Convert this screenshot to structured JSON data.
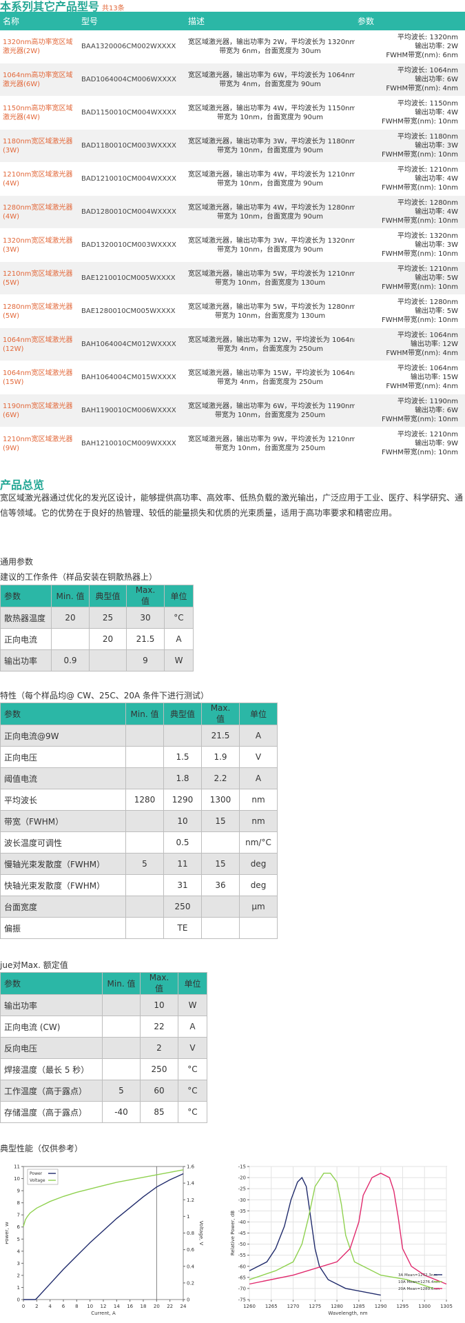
{
  "series_section": {
    "title": "本系列其它产品型号",
    "count": "共13条",
    "headers": [
      "名称",
      "型号",
      "描述",
      "参数"
    ],
    "rows": [
      {
        "name": "1320nm高功率宽区域激光器(2W)",
        "model": "BAA1320006CM002WXXXX",
        "desc": [
          "宽区域激光器，输出功率为 2W，平均波长为 1320nm,",
          "带宽为 6nm，台面宽度为 30um"
        ],
        "params": [
          "平均波长: 1320nm",
          "输出功率: 2W",
          "FWHM带宽(nm): 6nm"
        ]
      },
      {
        "name": "1064nm高功率宽区域激光器(6W)",
        "model": "BAD1064004CM006WXXXX",
        "desc": [
          "宽区域激光器，输出功率为 6W，平均波长为 1064nm,",
          "带宽为 4nm，台面宽度为 90um"
        ],
        "params": [
          "平均波长: 1064nm",
          "输出功率: 6W",
          "FWHM带宽(nm): 4nm"
        ]
      },
      {
        "name": "1150nm高功率宽区域激光器(4W)",
        "model": "BAD1150010CM004WXXXX",
        "desc": [
          "宽区域激光器，输出功率为 4W，平均波长为 1150nm,",
          "带宽为 10nm，台面宽度为 90um"
        ],
        "params": [
          "平均波长: 1150nm",
          "输出功率: 4W",
          "FWHM带宽(nm): 10nm"
        ]
      },
      {
        "name": "1180nm宽区域激光器(3W)",
        "model": "BAD1180010CM003WXXXX",
        "desc": [
          "宽区域激光器，输出功率为 3W，平均波长为 1180nm,",
          "带宽为 10nm，台面宽度为 90um"
        ],
        "params": [
          "平均波长: 1180nm",
          "输出功率: 3W",
          "FWHM带宽(nm): 10nm"
        ]
      },
      {
        "name": "1210nm宽区域激光器(4W)",
        "model": "BAD1210010CM004WXXXX",
        "desc": [
          "宽区域激光器，输出功率为 4W，平均波长为 1210nm,",
          "带宽为 10nm，台面宽度为 90um"
        ],
        "params": [
          "平均波长: 1210nm",
          "输出功率: 4W",
          "FWHM带宽(nm): 10nm"
        ]
      },
      {
        "name": "1280nm宽区域激光器(4W)",
        "model": "BAD1280010CM004WXXXX",
        "desc": [
          "宽区域激光器，输出功率为 4W，平均波长为 1280nm,",
          "带宽为 10nm，台面宽度为 90um"
        ],
        "params": [
          "平均波长: 1280nm",
          "输出功率: 4W",
          "FWHM带宽(nm): 10nm"
        ]
      },
      {
        "name": "1320nm宽区域激光器(3W)",
        "model": "BAD1320010CM003WXXXX",
        "desc": [
          "宽区域激光器，输出功率为 3W，平均波长为 1320nm,",
          "带宽为 10nm，台面宽度为 90um"
        ],
        "params": [
          "平均波长: 1320nm",
          "输出功率: 3W",
          "FWHM带宽(nm): 10nm"
        ]
      },
      {
        "name": "1210nm宽区域激光器(5W)",
        "model": "BAE1210010CM005WXXXX",
        "desc": [
          "宽区域激光器，输出功率为 5W，平均波长为 1210nm,",
          "带宽为 10nm，台面宽度为 130um"
        ],
        "params": [
          "平均波长: 1210nm",
          "输出功率: 5W",
          "FWHM带宽(nm): 10nm"
        ]
      },
      {
        "name": "1280nm宽区域激光器(5W)",
        "model": "BAE1280010CM005WXXXX",
        "desc": [
          "宽区域激光器，输出功率为 5W，平均波长为 1280nm,",
          "带宽为 10nm，台面宽度为 130um"
        ],
        "params": [
          "平均波长: 1280nm",
          "输出功率: 5W",
          "FWHM带宽(nm): 10nm"
        ]
      },
      {
        "name": "1064nm宽区域激光器(12W)",
        "model": "BAH1064004CM012WXXXX",
        "desc": [
          "宽区域激光器，输出功率为 12W，平均波长为 1064nm,",
          "带宽为 4nm，台面宽度为 250um"
        ],
        "params": [
          "平均波长: 1064nm",
          "输出功率: 12W",
          "FWHM带宽(nm): 4nm"
        ]
      },
      {
        "name": "1064nm宽区域激光器(15W)",
        "model": "BAH1064004CM015WXXXX",
        "desc": [
          "宽区域激光器，输出功率为 15W，平均波长为 1064nm,",
          "带宽为 4nm，台面宽度为 250um"
        ],
        "params": [
          "平均波长: 1064nm",
          "输出功率: 15W",
          "FWHM带宽(nm): 4nm"
        ]
      },
      {
        "name": "1190nm宽区域激光器(6W)",
        "model": "BAH1190010CM006WXXXX",
        "desc": [
          "宽区域激光器，输出功率为 6W，平均波长为 1190nm,",
          "带宽为 10nm，台面宽度为 250um"
        ],
        "params": [
          "平均波长: 1190nm",
          "输出功率: 6W",
          "FWHM带宽(nm): 10nm"
        ]
      },
      {
        "name": "1210nm宽区域激光器(9W)",
        "model": "BAH1210010CM009WXXXX",
        "desc": [
          "宽区域激光器，输出功率为 9W，平均波长为 1210nm,",
          "带宽为 10nm，台面宽度为 250um"
        ],
        "params": [
          "平均波长: 1210nm",
          "输出功率: 9W",
          "FWHM带宽(nm): 10nm"
        ]
      }
    ]
  },
  "overview": {
    "title": "产品总览",
    "text": "宽区域激光器通过优化的发光区设计，能够提供高功率、高效率、低热负载的激光输出，广泛应用于工业、医疗、科学研究、通信等领域。它的优势在于良好的热管理、较低的能量损失和优质的光束质量，适用于高功率要求和精密应用。"
  },
  "general": {
    "label": "通用参数",
    "cond_label": "建议的工作条件（样品安装在铜散热器上）",
    "headers": [
      "参数",
      "Min. 值",
      "典型值",
      "Max. 值",
      "单位"
    ],
    "rows": [
      [
        "散热器温度",
        "20",
        "25",
        "30",
        "°C"
      ],
      [
        "正向电流",
        "",
        "20",
        "21.5",
        "A"
      ],
      [
        "输出功率",
        "0.9",
        "",
        "9",
        "W"
      ]
    ]
  },
  "characteristics": {
    "label": "特性（每个样品均@ CW、25C、20A 条件下进行测试）",
    "headers": [
      "参数",
      "Min. 值",
      "典型值",
      "Max. 值",
      "单位"
    ],
    "rows": [
      [
        "正向电流@9W",
        "",
        "",
        "21.5",
        "A"
      ],
      [
        "正向电压",
        "",
        "1.5",
        "1.9",
        "V"
      ],
      [
        "阈值电流",
        "",
        "1.8",
        "2.2",
        "A"
      ],
      [
        "平均波长",
        "1280",
        "1290",
        "1300",
        "nm"
      ],
      [
        "带宽（FWHM）",
        "",
        "10",
        "15",
        "nm"
      ],
      [
        "波长温度可调性",
        "",
        "0.5",
        "",
        "nm/°C"
      ],
      [
        "慢轴光束发散度（FWHM）",
        "5",
        "11",
        "15",
        "deg"
      ],
      [
        "快轴光束发散度（FWHM）",
        "",
        "31",
        "36",
        "deg"
      ],
      [
        "台面宽度",
        "",
        "250",
        "",
        "μm"
      ],
      [
        "偏振",
        "",
        "TE",
        "",
        ""
      ]
    ]
  },
  "absolute": {
    "label": "jue对Max. 额定值",
    "headers": [
      "参数",
      "Min. 值",
      "Max. 值",
      "单位"
    ],
    "rows": [
      [
        "输出功率",
        "",
        "10",
        "W"
      ],
      [
        "正向电流 (CW)",
        "",
        "22",
        "A"
      ],
      [
        "反向电压",
        "",
        "2",
        "V"
      ],
      [
        "焊接温度（最长 5 秒）",
        "",
        "250",
        "°C"
      ],
      [
        "工作温度（高于露点）",
        "5",
        "60",
        "°C"
      ],
      [
        "存储温度（高于露点）",
        "-40",
        "85",
        "°C"
      ]
    ]
  },
  "performance": {
    "label": "典型性能（仅供参考）"
  },
  "chart_data": [
    {
      "type": "line",
      "xlabel": "Current, A",
      "ylabel": "Power, W",
      "y2label": "Voltage, V",
      "xlim": [
        0,
        24
      ],
      "ylim": [
        0,
        11
      ],
      "y2lim": [
        0,
        1.6
      ],
      "xticks": [
        "0",
        "2",
        "4",
        "6",
        "8",
        "10",
        "12",
        "14",
        "16",
        "18",
        "20",
        "22",
        "24"
      ],
      "yticks": [
        "0",
        "1",
        "2",
        "3",
        "4",
        "5",
        "6",
        "7",
        "8",
        "9",
        "10",
        "11"
      ],
      "y2ticks": [
        "0",
        "0.2",
        "0.4",
        "0.6",
        "0.8",
        "1",
        "1.2",
        "1.4",
        "1.6"
      ],
      "series": [
        {
          "name": "Power",
          "color": "#1f2a6b",
          "axis": "y",
          "x": [
            0,
            1.8,
            2,
            4,
            6,
            8,
            10,
            12,
            14,
            16,
            18,
            20,
            22,
            24
          ],
          "y": [
            0,
            0,
            0.1,
            1.3,
            2.5,
            3.6,
            4.7,
            5.7,
            6.7,
            7.6,
            8.5,
            9.3,
            9.9,
            10.4
          ]
        },
        {
          "name": "Voltage",
          "color": "#8fd14f",
          "axis": "y2",
          "x": [
            0,
            0.3,
            0.6,
            1,
            2,
            4,
            6,
            8,
            10,
            12,
            14,
            16,
            18,
            20,
            22,
            24
          ],
          "y": [
            0.88,
            0.96,
            1.0,
            1.04,
            1.1,
            1.18,
            1.24,
            1.29,
            1.33,
            1.37,
            1.41,
            1.44,
            1.47,
            1.5,
            1.53,
            1.56
          ]
        }
      ],
      "legend": "top-left"
    },
    {
      "type": "line",
      "xlabel": "Wavelength, nm",
      "ylabel": "Relative Power, dB",
      "xlim": [
        1260,
        1305
      ],
      "ylim": [
        -75,
        -15
      ],
      "xticks": [
        "1260",
        "1265",
        "1270",
        "1275",
        "1280",
        "1285",
        "1290",
        "1295",
        "1300",
        "1305"
      ],
      "yticks": [
        "-15",
        "-20",
        "-25",
        "-30",
        "-35",
        "-40",
        "-45",
        "-50",
        "-55",
        "-60",
        "-65",
        "-70",
        "-75"
      ],
      "series": [
        {
          "name": "3A Mean=1272.3nm",
          "color": "#1f2a6b",
          "x": [
            1260,
            1264,
            1266,
            1268,
            1269.5,
            1271,
            1272,
            1273,
            1274,
            1275,
            1276,
            1278,
            1282,
            1290
          ],
          "y": [
            -62,
            -58,
            -52,
            -42,
            -30,
            -22,
            -20,
            -24,
            -38,
            -52,
            -60,
            -66,
            -70,
            -73
          ]
        },
        {
          "name": "10A Mean=1276.4nm",
          "color": "#8fd14f",
          "x": [
            1260,
            1266,
            1270,
            1272,
            1273.5,
            1275,
            1277,
            1278.5,
            1280,
            1281,
            1282,
            1284,
            1290,
            1296,
            1302
          ],
          "y": [
            -66,
            -62,
            -58,
            -50,
            -38,
            -24,
            -18,
            -18,
            -22,
            -32,
            -46,
            -58,
            -64,
            -66,
            -70
          ]
        },
        {
          "name": "20A Mean=1289.0nm",
          "color": "#e0286c",
          "x": [
            1260,
            1270,
            1280,
            1283,
            1285,
            1286,
            1288,
            1290,
            1292,
            1293,
            1294,
            1295,
            1297,
            1300,
            1305
          ],
          "y": [
            -68,
            -64,
            -58,
            -52,
            -40,
            -28,
            -20,
            -18,
            -20,
            -26,
            -38,
            -52,
            -60,
            -64,
            -68
          ]
        }
      ],
      "legend": "bottom-right"
    }
  ],
  "colors": {
    "teal": "#2bb7a6",
    "title": "#24a795",
    "link": "#e2683a",
    "stripe": "#f1f1f1"
  }
}
